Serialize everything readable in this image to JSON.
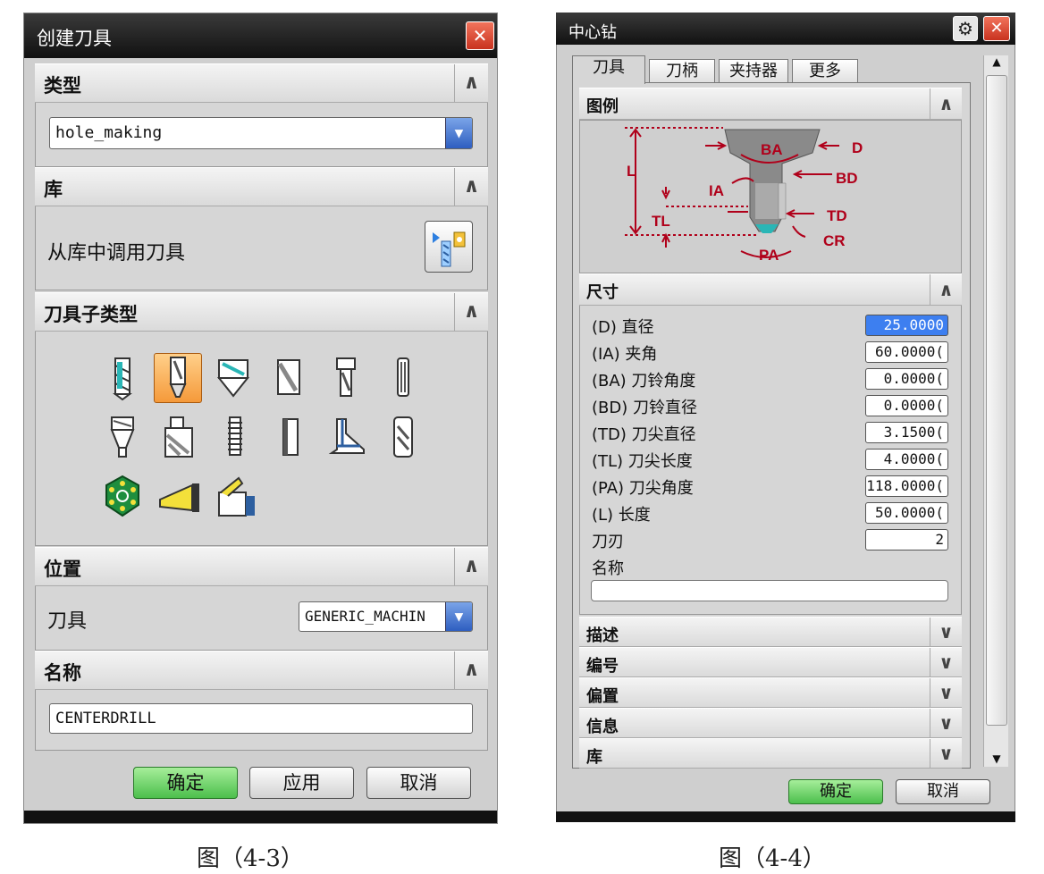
{
  "left_dialog": {
    "title": "创建刀具",
    "close_label": "✕",
    "type_section": {
      "label": "类型",
      "value": "hole_making"
    },
    "library_section": {
      "label": "库",
      "text": "从库中调用刀具"
    },
    "subtype_section": {
      "label": "刀具子类型"
    },
    "position_section": {
      "label": "位置",
      "tool_label": "刀具",
      "tool_value": "GENERIC_MACHIN"
    },
    "name_section": {
      "label": "名称",
      "value": "CENTERDRILL"
    },
    "buttons": {
      "ok": "确定",
      "apply": "应用",
      "cancel": "取消"
    }
  },
  "right_dialog": {
    "title": "中心钻",
    "close_label": "✕",
    "gear_label": "⚙",
    "tabs": [
      "刀具",
      "刀柄",
      "夹持器",
      "更多"
    ],
    "legend_section": {
      "label": "图例"
    },
    "diagram_labels": {
      "BA": "BA",
      "D": "D",
      "BD": "BD",
      "L": "L",
      "IA": "IA",
      "TL": "TL",
      "TD": "TD",
      "CR": "CR",
      "PA": "PA"
    },
    "dimensions_section": {
      "label": "尺寸"
    },
    "dimensions": [
      {
        "label": "(D) 直径",
        "value": "25.0000"
      },
      {
        "label": "(IA) 夹角",
        "value": "60.0000("
      },
      {
        "label": "(BA) 刀铃角度",
        "value": "0.0000("
      },
      {
        "label": "(BD) 刀铃直径",
        "value": "0.0000("
      },
      {
        "label": "(TD) 刀尖直径",
        "value": "3.1500("
      },
      {
        "label": "(TL) 刀尖长度",
        "value": "4.0000("
      },
      {
        "label": "(PA) 刀尖角度",
        "value": "118.0000("
      },
      {
        "label": "(L) 长度",
        "value": "50.0000("
      },
      {
        "label": "刀刃",
        "value": "2"
      }
    ],
    "name_label": "名称",
    "collapsed_sections": [
      "描述",
      "编号",
      "偏置",
      "信息",
      "库"
    ],
    "buttons": {
      "ok": "确定",
      "cancel": "取消"
    }
  },
  "captions": {
    "left": "图（4-3）",
    "right": "图（4-4）"
  },
  "colors": {
    "accent_orange": "#f59a3a",
    "ok_green": "#4cbf4c",
    "dropdown_blue": "#2e5ec0",
    "diagram_red": "#b0001a"
  }
}
